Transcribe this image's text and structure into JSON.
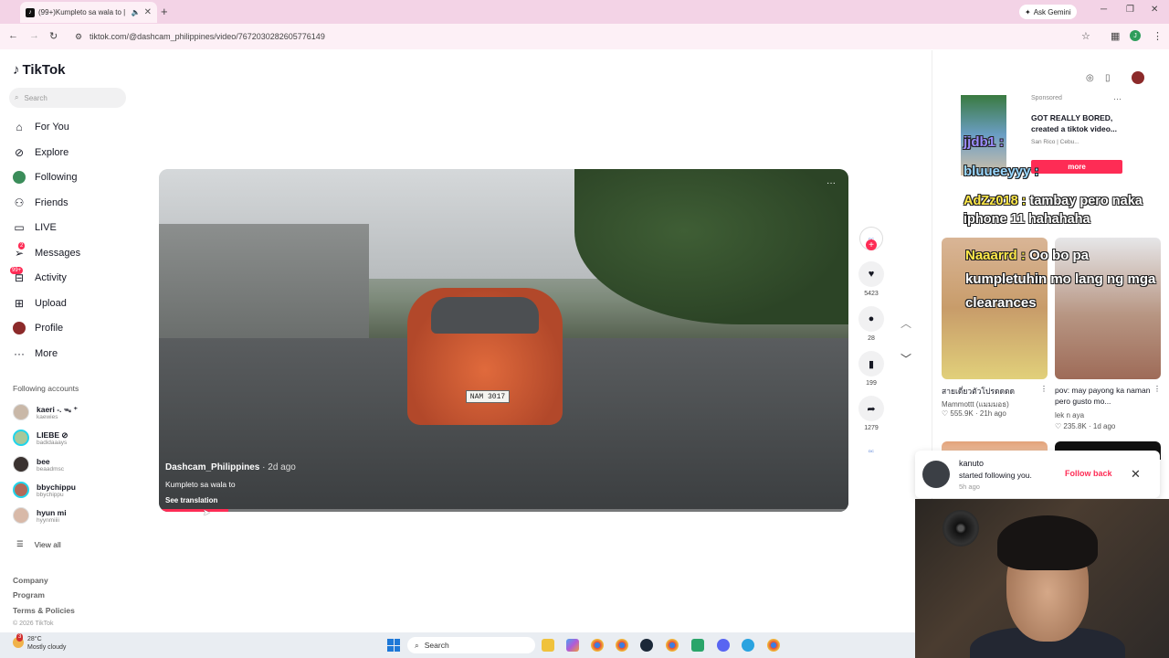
{
  "browser": {
    "tab_title": "(99+)Kumpleto sa wala to |",
    "ask_gemini": "Ask Gemini",
    "url": "tiktok.com/@dashcam_philippines/video/7672030282605776149",
    "profile_initial": "J"
  },
  "sidebar": {
    "logo": "TikTok",
    "search_placeholder": "Search",
    "nav": [
      {
        "label": "For You",
        "icon": "home-icon"
      },
      {
        "label": "Explore",
        "icon": "compass-icon"
      },
      {
        "label": "Following",
        "icon": "avatar"
      },
      {
        "label": "Friends",
        "icon": "friends-icon"
      },
      {
        "label": "LIVE",
        "icon": "live-icon"
      },
      {
        "label": "Messages",
        "icon": "messages-icon",
        "badge": "2"
      },
      {
        "label": "Activity",
        "icon": "activity-icon",
        "badge": "99+"
      },
      {
        "label": "Upload",
        "icon": "upload-icon"
      },
      {
        "label": "Profile",
        "icon": "profile-avatar"
      },
      {
        "label": "More",
        "icon": "more-icon"
      }
    ],
    "following_title": "Following accounts",
    "accounts": [
      {
        "name": "kaeri -. ᯓ ⁺",
        "handle": "kaewies"
      },
      {
        "name": "LIEBE ⊘",
        "handle": "badidaaays"
      },
      {
        "name": "bee",
        "handle": "beaadmsc"
      },
      {
        "name": "bbychippu",
        "handle": "bbychippu"
      },
      {
        "name": "hyun mi",
        "handle": "hyynmiiii"
      }
    ],
    "view_all": "View all",
    "footer": [
      "Company",
      "Program",
      "Terms & Policies"
    ],
    "copyright": "© 2026 TikTok"
  },
  "video": {
    "author": "Dashcam_Philippines",
    "ago": "· 2d ago",
    "caption": "Kumpleto sa wala to",
    "translation": "See translation",
    "plate": "NAM 3017",
    "progress": 0.1
  },
  "actions": {
    "likes": "5423",
    "comments": "28",
    "saves": "199",
    "shares": "1279"
  },
  "ad": {
    "sponsored": "Sponsored",
    "title": "GOT REALLY BORED, created a tiktok video...",
    "sub": "San Rico | Cebu...",
    "more": "more"
  },
  "chat": [
    {
      "user": "jjdb1 :",
      "text": ""
    },
    {
      "user": "bluueeyyy :",
      "text": ""
    },
    {
      "user": "AdZz018 :",
      "text": "tambay pero naka iphone 11 hahahaha"
    },
    {
      "user": "Naaarrd :",
      "text": "Oo bo pa kumpletuhin mo lang ng mga clearances"
    }
  ],
  "cards": [
    {
      "title": "สายเดี่ยวตัวโปรดดดด",
      "author": "Mammottt (แมมมอธ)",
      "likes": "555.9K",
      "ago": "21h ago"
    },
    {
      "title": "pov: may payong ka naman pero gusto mo...",
      "author": "lek n aya",
      "likes": "235.8K",
      "ago": "1d ago"
    }
  ],
  "notification": {
    "name": "kanuto",
    "text": "started following you.",
    "time": "5h ago",
    "follow_back": "Follow back"
  },
  "taskbar": {
    "temp": "28°C",
    "weather": "Mostly cloudy",
    "weather_badge": "3",
    "search": "Search"
  }
}
